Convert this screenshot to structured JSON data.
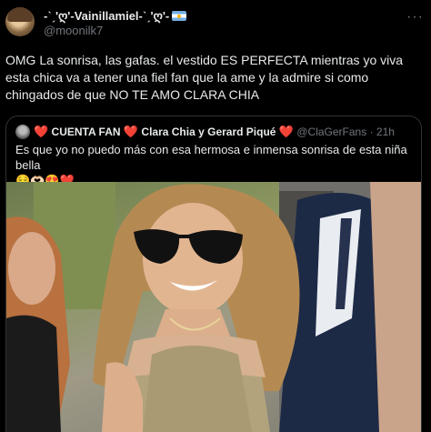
{
  "author": {
    "display_name": "-ˋˏ'ღ'-Vainillamiel-ˋˏ'ღ'-",
    "flag_icon": "argentina-flag-icon",
    "handle": "@moonilk7"
  },
  "menu_icon": "more-options-icon",
  "tweet_text": "OMG La sonrisa, las gafas. el vestido  ES PERFECTA  mientras yo viva\nesta chica va a tener una fiel fan que la ame y la admire si  como\nchingados de que NO TE AMO CLARA CHIA",
  "quoted": {
    "prefix_heart": "❤️",
    "account": "CUENTA FAN",
    "name": "Clara Chia y Gerard Piqué",
    "suffix_heart": "❤️",
    "handle": "@ClaGerFans",
    "separator": "·",
    "time": "21h",
    "text": "Es que yo no puedo más con esa hermosa e inmensa sonrisa de esta niña bella",
    "emojis": "😌🫶🏻😍❤️",
    "image_alt": "photo-of-smiling-woman-with-sunglasses"
  },
  "colors": {
    "background": "#000000",
    "text": "#e7e9ea",
    "muted": "#71767b",
    "border": "#2f3336",
    "heart": "#f91880"
  }
}
